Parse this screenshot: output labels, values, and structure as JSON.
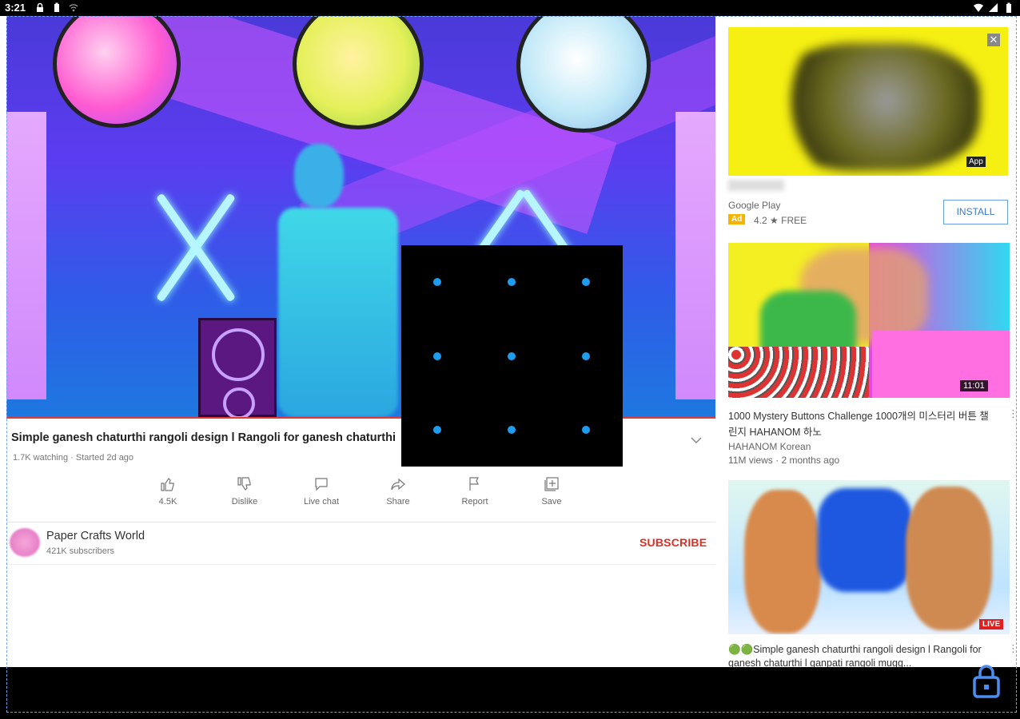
{
  "status_bar": {
    "time": "3:21",
    "left_icons": [
      "lock-icon",
      "battery-saver-icon",
      "wifi-calling-icon"
    ],
    "right_icons": [
      "wifi-icon",
      "signal-icon",
      "battery-icon"
    ]
  },
  "video": {
    "overlay_pattern": "3x3 lock pattern grid",
    "title": "Simple ganesh chaturthi rangoli design l Rangoli for ganesh chaturthi",
    "meta": "1.7K watching · Started 2d ago"
  },
  "actions": [
    {
      "label": "4.5K",
      "icon": "thumbs-up-icon"
    },
    {
      "label": "Dislike",
      "icon": "thumbs-down-icon"
    },
    {
      "label": "Live chat",
      "icon": "chat-icon"
    },
    {
      "label": "Share",
      "icon": "share-icon"
    },
    {
      "label": "Report",
      "icon": "flag-icon"
    },
    {
      "label": "Save",
      "icon": "add-to-playlist-icon"
    }
  ],
  "channel": {
    "name": "Paper Crafts World",
    "subscribers": "421K subscribers",
    "subscribe_label": "SUBSCRIBE"
  },
  "sidebar": {
    "ad": {
      "close": "✕",
      "tag": "App",
      "advertiser": "Google Play",
      "badge": "Ad",
      "rating": "4.2 ★ FREE",
      "install_label": "INSTALL"
    },
    "videos": [
      {
        "title": "1000 Mystery Buttons Challenge 1000개의 미스터리 버튼 챌린지 HAHANOM 하노",
        "channel": "HAHANOM Korean",
        "stats": "11M views · 2 months ago",
        "duration": "11:01",
        "more": "⋮"
      },
      {
        "title": "🟢🟢Simple ganesh chaturthi rangoli design l Rangoli for ganesh chaturthi l ganpati rangoli mugg...",
        "badge": "LIVE",
        "more": "⋮"
      }
    ]
  },
  "colors": {
    "accent_red": "#d93025",
    "pattern_dot": "#1e9df0",
    "install_blue": "#3a78d0",
    "ad_badge": "#f4b400"
  }
}
